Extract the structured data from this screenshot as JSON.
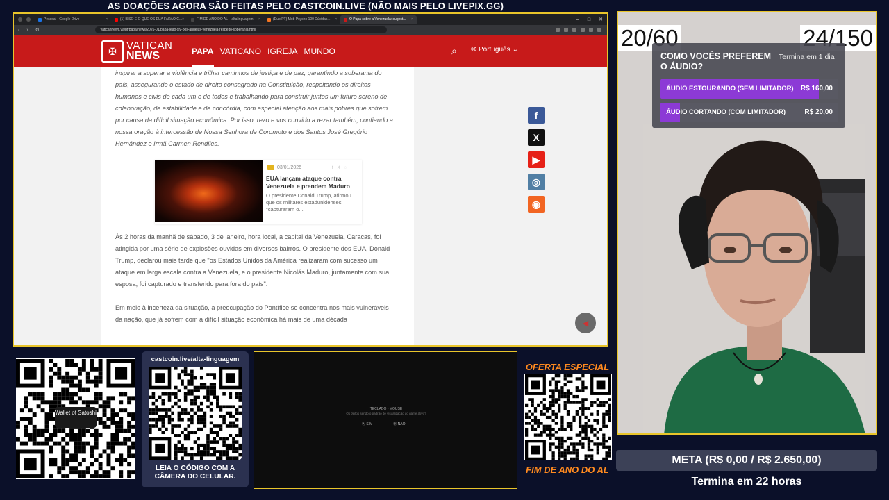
{
  "banner": "AS DOAÇÕES AGORA SÃO FEITAS PELO CASTCOIN.LIVE (NÃO MAIS PELO LIVEPIX.GG)",
  "browser": {
    "tabs": [
      {
        "label": "Pessoal - Google Drive",
        "color": "#1a73e8"
      },
      {
        "label": "(1) ISSO É O QUE OS EUA FARÃO C...",
        "color": "#ff0000"
      },
      {
        "label": "FIM DE ANO DO AL – altalinguagem",
        "color": "#444444"
      },
      {
        "label": "(Dub PT) Mob Psycho 100 Dúvidas...",
        "color": "#f47521"
      },
      {
        "label": "O Papa sobre a Venezuela: sugest...",
        "color": "#c71a1a"
      }
    ],
    "url": "vaticannews.va/pt/papa/news/2026-01/papa-leao-xiv-pos-angelus-venezuela-respeito-soberania.html"
  },
  "site": {
    "logo_line1": "VATICAN",
    "logo_line2": "NEWS",
    "nav": [
      "PAPA",
      "VATICANO",
      "IGREJA",
      "MUNDO"
    ],
    "language": "Português"
  },
  "article": {
    "para1": "inspirar a superar a violência e trilhar caminhos de justiça e de paz, garantindo a soberania do país, assegurando o estado de direito consagrado na Constituição, respeitando os direitos humanos e civis de cada um e de todos e trabalhando para construir juntos um futuro sereno de colaboração, de estabilidade e de concórdia, com especial atenção aos mais pobres que sofrem por causa da difícil situação econômica. Por isso, rezo e vos convido a rezar também, confiando a nossa oração à intercessão de Nossa Senhora de Coromoto e dos Santos José Gregório Hernández e Irmã Carmen Rendiles.",
    "card": {
      "date": "03/01/2026",
      "title": "EUA lançam ataque contra Venezuela e prendem Maduro",
      "desc": "O presidente Donald Trump, afirmou que os militares estadunidenses \"capturaram o..."
    },
    "para2": "Às 2 horas da manhã de sábado, 3 de janeiro, hora local, a capital da Venezuela, Caracas, foi atingida por uma série de explosões ouvidas em diversos bairros. O presidente dos EUA, Donald Trump, declarou mais tarde que \"os Estados Unidos da América realizaram com sucesso um ataque em larga escala contra a Venezuela, e o presidente Nicolás Maduro, juntamente com sua esposa, foi capturado e transferido para fora do país\".",
    "para3": "Em meio à incerteza da situação, a preocupação do Pontífice se concentra nos mais vulneráveis da nação, que já sofrem com a difícil situação econômica há mais de uma década"
  },
  "social": [
    {
      "icon": "facebook-icon",
      "glyph": "f",
      "color": "#3b5998"
    },
    {
      "icon": "x-icon",
      "glyph": "X",
      "color": "#111111"
    },
    {
      "icon": "youtube-icon",
      "glyph": "▶",
      "color": "#e62117"
    },
    {
      "icon": "instagram-icon",
      "glyph": "◎",
      "color": "#517fa4"
    },
    {
      "icon": "rss-icon",
      "glyph": "◉",
      "color": "#f26522"
    }
  ],
  "counters": {
    "left": "20/60",
    "right": "24/150"
  },
  "poll": {
    "question": "COMO VOCÊS PREFEREM O ÁUDIO?",
    "ends": "Termina em 1 dia",
    "options": [
      {
        "label": "ÁUDIO ESTOURANDO (SEM LIMITADOR)",
        "value": "R$ 160,00",
        "share": 0.89
      },
      {
        "label": "ÁUDIO CORTANDO (COM LIMITADOR)",
        "value": "R$ 20,00",
        "share": 0.11
      }
    ]
  },
  "qr1": {
    "wallet": "Wallet of Satoshi"
  },
  "qr2": {
    "top": "castcoin.live/alta-linguagem",
    "caption": "LEIA O CÓDIGO COM A CÂMERA DO CELULAR."
  },
  "dialog": {
    "title": "TECLADO - MOUSE",
    "text": "Os Jeitos sendo o padrão de visualização do game ativo?",
    "yes": "SIM",
    "no": "NÃO"
  },
  "oferta": {
    "top": "OFERTA ESPECIAL",
    "bottom": "FIM DE ANO DO AL"
  },
  "meta": {
    "goal": "META (R$ 0,00 / R$ 2.650,00)",
    "ends": "Termina em 22 horas"
  }
}
